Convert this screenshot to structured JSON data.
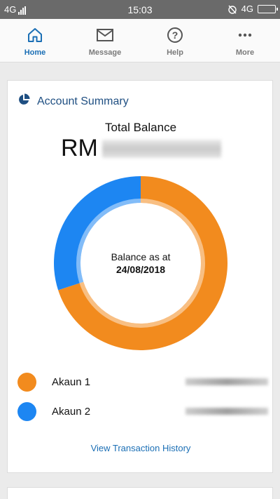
{
  "status_bar": {
    "network_left": "4G",
    "time": "15:03",
    "network_right": "4G"
  },
  "nav": {
    "items": [
      {
        "label": "Home",
        "icon": "home-icon",
        "active": true
      },
      {
        "label": "Message",
        "icon": "mail-icon",
        "active": false
      },
      {
        "label": "Help",
        "icon": "help-icon",
        "active": false
      },
      {
        "label": "More",
        "icon": "more-icon",
        "active": false
      }
    ]
  },
  "account_summary": {
    "title": "Account Summary",
    "total_balance_label": "Total Balance",
    "currency": "RM",
    "balance_as_at_label": "Balance as at",
    "balance_date": "24/08/2018",
    "view_history_label": "View Transaction History",
    "accounts": [
      {
        "label": "Akaun 1",
        "color": "#f28b1e"
      },
      {
        "label": "Akaun 2",
        "color": "#1d86f2"
      }
    ]
  },
  "chart_data": {
    "type": "pie",
    "donut": true,
    "labels": [
      "Akaun 1",
      "Akaun 2"
    ],
    "values": [
      70,
      30
    ],
    "colors": [
      "#f28b1e",
      "#1d86f2"
    ]
  }
}
